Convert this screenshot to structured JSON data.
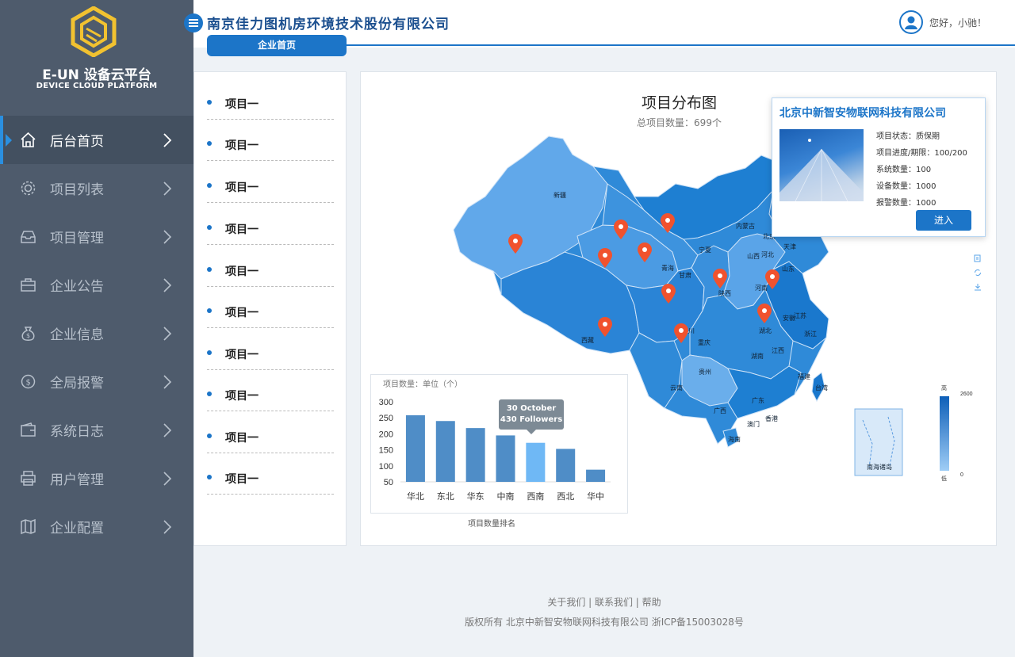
{
  "brand": {
    "title": "E-UN 设备云平台",
    "subtitle": "DEVICE CLOUD PLATFORM"
  },
  "header": {
    "company": "南京佳力图机房环境技术股份有限公司",
    "greeting": "您好，小驰！",
    "tab": "企业首页"
  },
  "sidebar": {
    "items": [
      {
        "label": "后台首页",
        "icon": "home-icon",
        "active": true
      },
      {
        "label": "项目列表",
        "icon": "gear-icon"
      },
      {
        "label": "项目管理",
        "icon": "inbox-icon"
      },
      {
        "label": "企业公告",
        "icon": "briefcase-icon"
      },
      {
        "label": "企业信息",
        "icon": "money-bag-icon"
      },
      {
        "label": "全局报警",
        "icon": "coin-icon"
      },
      {
        "label": "系统日志",
        "icon": "wallet-icon"
      },
      {
        "label": "用户管理",
        "icon": "printer-icon"
      },
      {
        "label": "企业配置",
        "icon": "map-icon"
      }
    ]
  },
  "project_list": [
    "项目一",
    "项目一",
    "项目一",
    "项目一",
    "项目一",
    "项目一",
    "项目一",
    "项目一",
    "项目一",
    "项目一"
  ],
  "map": {
    "title": "项目分布图",
    "subtitle": "总项目数量：699个",
    "provinces": [
      "新疆",
      "西藏",
      "青海",
      "甘肃",
      "宁夏",
      "内蒙古",
      "山西",
      "河北",
      "北京",
      "天津",
      "山东",
      "河南",
      "陕西",
      "四川",
      "重庆",
      "湖北",
      "安徽",
      "江苏",
      "浙江",
      "湖南",
      "江西",
      "贵州",
      "云南",
      "广西",
      "广东",
      "福建",
      "台湾",
      "海南",
      "香港",
      "澳门"
    ],
    "legend": {
      "max": "高",
      "min": "低",
      "max_value": "2600",
      "min_value": "0"
    },
    "inset_label": "南海诸岛"
  },
  "popup": {
    "company": "北京中新智安物联网科技有限公司",
    "rows": [
      "项目状态：质保期",
      "项目进度/期限：100/200",
      "系统数量：100",
      "设备数量：1000",
      "报警数量：1000"
    ],
    "button": "进入"
  },
  "chart_data": {
    "type": "bar",
    "title": "项目数量：单位（个）",
    "xlabel": "项目数量排名",
    "categories": [
      "华北",
      "东北",
      "华东",
      "中南",
      "西南",
      "西北",
      "华中"
    ],
    "values": [
      258,
      240,
      218,
      195,
      172,
      153,
      88
    ],
    "yticks": [
      50,
      100,
      150,
      200,
      250,
      300
    ],
    "highlight_index": 4,
    "tooltip": [
      "30 October",
      "430 Followers"
    ],
    "colors": {
      "bar": "#4f8dc7",
      "highlight": "#6fb8f5"
    }
  },
  "footer": {
    "links": "关于我们 | 联系我们 | 帮助",
    "copyright": "版权所有  北京中新智安物联网科技有限公司 浙ICP备15003028号"
  }
}
